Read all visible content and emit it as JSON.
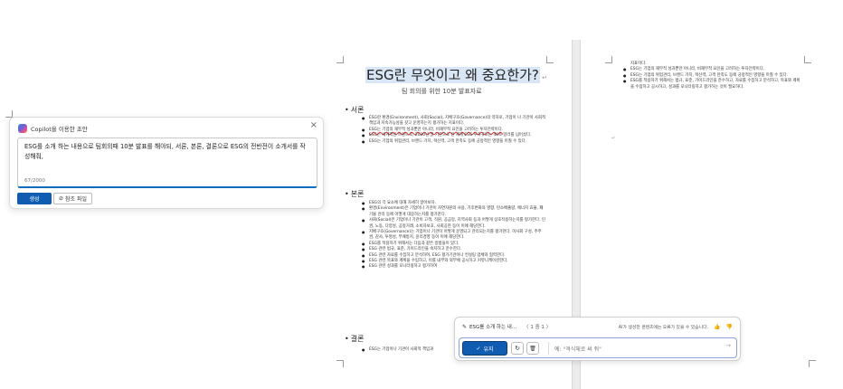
{
  "copilot_prompt": {
    "title": "Copilot을 이용한 초안",
    "close_icon": "×",
    "prompt_text": "ESG를 소개 하는 내용으로 팀회의때 10분 발표를 해야되, 서론, 본론, 결론으로 ESG의 전반전이 소개서를 작성해줘,",
    "char_count": "67/2000",
    "generate_label": "생성",
    "reference_label": "참조 파일",
    "reference_icon": "⊘"
  },
  "document": {
    "title": "ESG란 무엇이고 왜 중요한가?",
    "subtitle": "팀 회의를 위한 10분 발표자료",
    "intro_heading": "서론",
    "intro_items": [
      "ESG란 환경(Environment), 사회(Social), 지배구조(Governance)의 약자로, 기업이 나 기관이 사회적 책임과 지속가능성을 갖고 운영하는지 평가하는 지표이다.",
      "ESG는 기업의 재무적 성과뿐만 아니라, 비재무적 요인을 고려하는 투자전략이다.",
      "ESG는 세계적인 트렌드로, 2020년 말 기준으로 전 세계 ESG 투자규모는 40조 달러를 넘어섰다.",
      "ESG는 기업의 위험관리, 브랜드 가치, 혁신력, 고객 만족도 등에 긍정적인 영향을 미칠 수 있다."
    ],
    "body_heading": "본론",
    "body_items": [
      "ESG의 각 요소에 대해 자세히 알아보자.",
      "환경(Environment)은 기업이나 기관이 자연자원의 사용, 기후변화의 영향, 탄소배출량, 에너지 효율, 폐기물 관리 등에 어떻게 대응하는지를 평가한다.",
      "사회(Social)은 기업이나 기관이 고객, 직원, 공급망, 지역사회 등과 어떻게 상호작용하는지를 평가한다. 인권, 노동, 다양성, 공정거래, 소비자보호, 사회공헌 등이 이에 해당한다.",
      "지배구조(Governance)는 기업이나 기관이 어떻게 운영되고 관리되는지를 평가한다. 이사회 구성, 주주권, 감사, 투명성, 부패방지, 윤리경영 등이 이에 해당한다.",
      "ESG를 적용하기 위해서는 다음과 같은 방법들이 있다.",
      "ESG 관련 법규, 표준, 가이드라인을 숙지하고 준수한다.",
      "ESG 관련 자료를 수집하고 분석하여, ESG 평가기관이나 컨설팅 업체와 협력한다.",
      "ESG 관련 목표와 계획을 수립하고, 이를 내부와 외부에 공시하고 커뮤니케이션한다.",
      "ESG 관련 성과를 모니터링하고 평가하여"
    ],
    "conclusion_heading": "결론",
    "conclusion_items": [
      "ESG는 기업이나 기관이 사회적 책임과"
    ]
  },
  "page2": {
    "lead_line": "지표이다.",
    "items": [
      "ESG는 기업의 재무적 성과뿐만 아니라, 비재무적 요인을 고려하는 투자전략이다.",
      "ESG는 기업의 위험관리, 브랜드 가치, 혁신력, 고객 만족도 등에 긍정적인 영향을 미칠 수 있다.",
      "ESG를 적용하기 위해서는 법규, 표준, 가이드라인을 준수하고, 자료를 수집하고 분석하고, 목표와 계획을 수립하고 공시하고, 성과를 모니터링하고 평가하는 것이 필요하다."
    ],
    "cursor_glyph": "↵"
  },
  "rewrite_bar": {
    "pen_icon": "✎",
    "context_label": "ESG를 소개 하는 내...",
    "nav_text": "〈 1 중 1 〉",
    "disclaimer": "AI가 생성한 콘텐츠에는 오류가 있을 수 있습니다.",
    "thumb_up_icon": "👍",
    "thumb_down_icon": "👎",
    "keep_label": "유지",
    "keep_icon": "✓",
    "regenerate_icon": "↻",
    "discard_icon": "🗑",
    "input_placeholder": "예: \"격식체로 써 줘\"",
    "send_icon": "→"
  }
}
